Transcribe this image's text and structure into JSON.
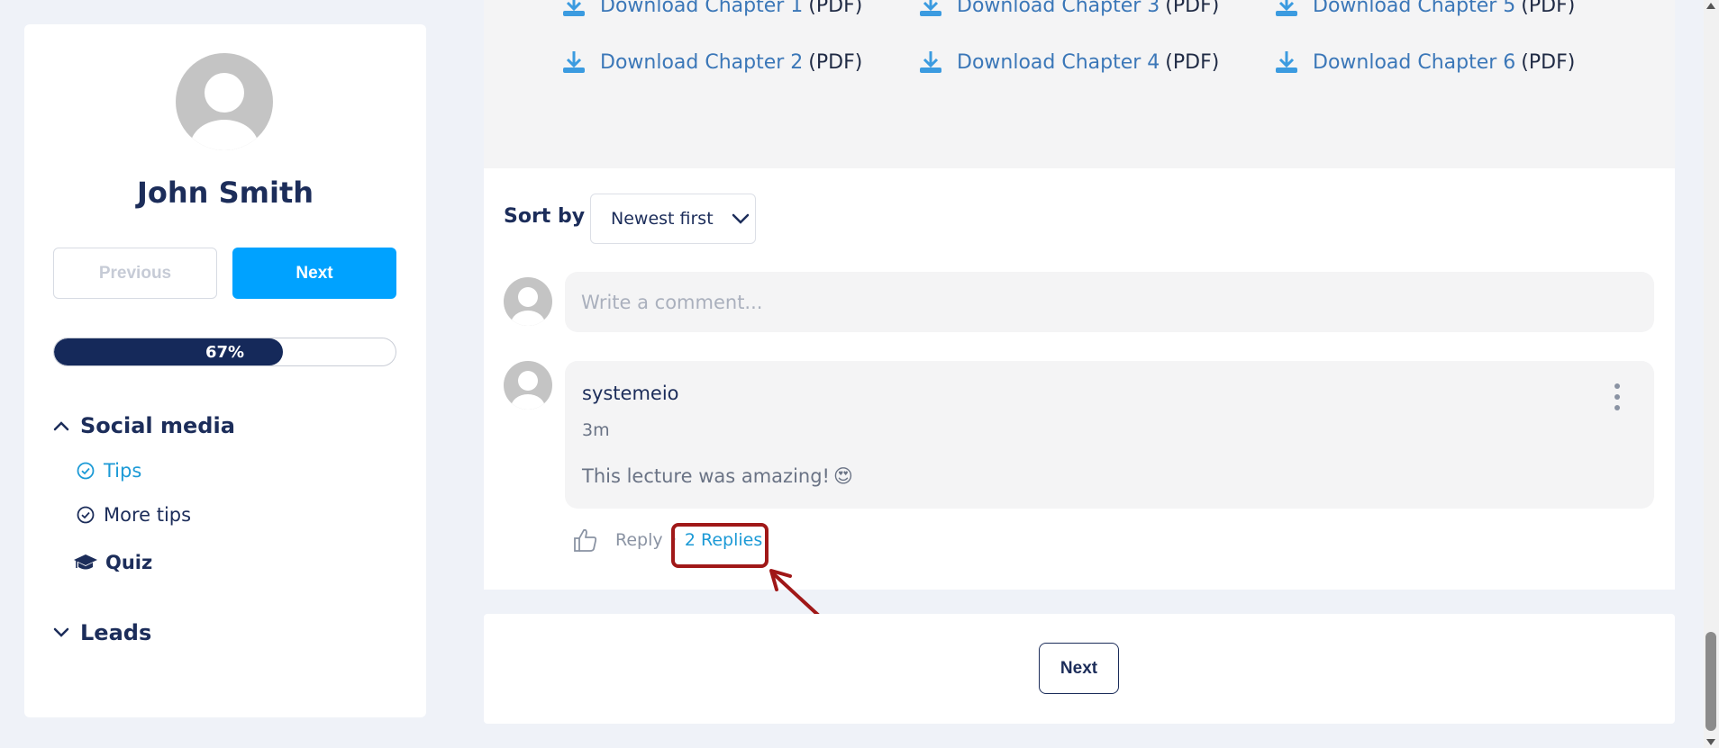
{
  "sidebar": {
    "user_name": "John Smith",
    "prev_label": "Previous",
    "next_label": "Next",
    "progress_text": "67%",
    "progress_fraction": 0.67,
    "sections": [
      {
        "title": "Social media",
        "expanded": true,
        "lessons": [
          {
            "label": "Tips",
            "active": true,
            "icon": "check-circle-icon"
          },
          {
            "label": "More tips",
            "active": false,
            "icon": "check-circle-icon"
          },
          {
            "label": "Quiz",
            "active": false,
            "icon": "graduation-cap-icon"
          }
        ]
      },
      {
        "title": "Leads",
        "expanded": false
      }
    ]
  },
  "downloads": [
    {
      "link": "Download Chapter 1",
      "suffix": "(PDF)"
    },
    {
      "link": "Download Chapter 2",
      "suffix": "(PDF)"
    },
    {
      "link": "Download Chapter 3",
      "suffix": "(PDF)"
    },
    {
      "link": "Download Chapter 4",
      "suffix": "(PDF)"
    },
    {
      "link": "Download Chapter 5",
      "suffix": "(PDF)"
    },
    {
      "link": "Download Chapter 6",
      "suffix": "(PDF)"
    }
  ],
  "comments": {
    "sort_label": "Sort by",
    "sort_value": "Newest first",
    "input_placeholder": "Write a comment...",
    "items": [
      {
        "author": "systemeio",
        "time": "3m",
        "text": "This lecture was amazing!",
        "emoji": "😍",
        "reply_label": "Reply",
        "replies_label": "2 Replies"
      }
    ]
  },
  "footer": {
    "next_label": "Next"
  },
  "colors": {
    "accent": "#00a2ff",
    "navy": "#1c2d5a",
    "link": "#3b77b8",
    "highlight": "#a01818"
  }
}
